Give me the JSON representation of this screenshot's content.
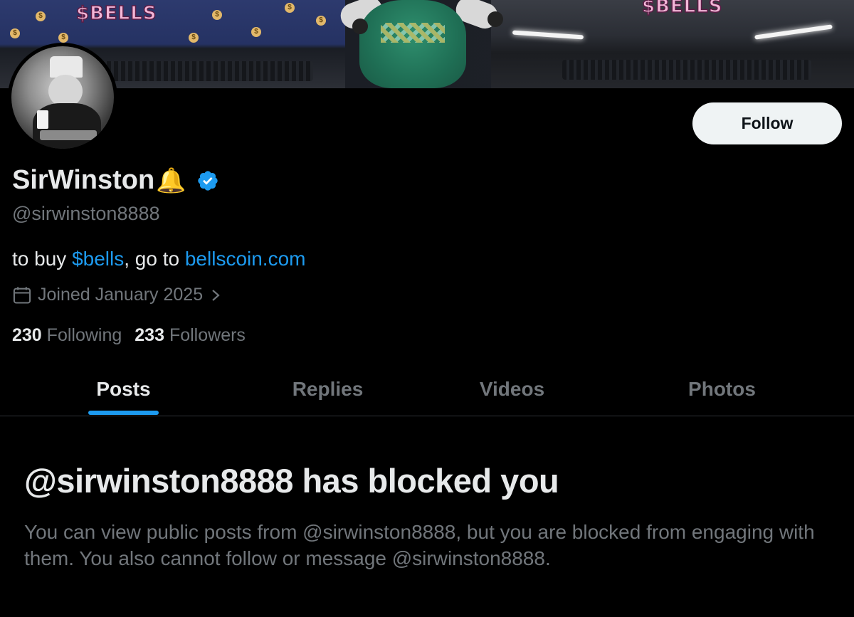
{
  "banner": {
    "left_logo": "$BELLS",
    "right_logo": "$BELLS",
    "bag_glyph": "$"
  },
  "profile": {
    "display_name": "SirWinston",
    "name_emoji": "🔔",
    "handle": "@sirwinston8888",
    "bio": {
      "prefix": "to buy ",
      "cashtag": "$bells",
      "middle": ", go to ",
      "link": "bellscoin.com"
    },
    "joined": "Joined January 2025",
    "following_count": "230",
    "following_label": "Following",
    "followers_count": "233",
    "followers_label": "Followers"
  },
  "actions": {
    "follow_label": "Follow"
  },
  "tabs": [
    {
      "label": "Posts",
      "active": true
    },
    {
      "label": "Replies",
      "active": false
    },
    {
      "label": "Videos",
      "active": false
    },
    {
      "label": "Photos",
      "active": false
    }
  ],
  "blocked": {
    "title": "@sirwinston8888 has blocked you",
    "message": "You can view public posts from @sirwinston8888, but you are blocked from engaging with them. You also cannot follow or message @sirwinston8888."
  },
  "colors": {
    "background": "#000000",
    "accent": "#1d9bf0",
    "secondary_text": "#71767b",
    "primary_text": "#e7e9ea",
    "follow_button_bg": "#eff3f4"
  },
  "icons": [
    "verified-badge-icon",
    "calendar-icon",
    "chevron-right-icon",
    "bell-emoji"
  ]
}
